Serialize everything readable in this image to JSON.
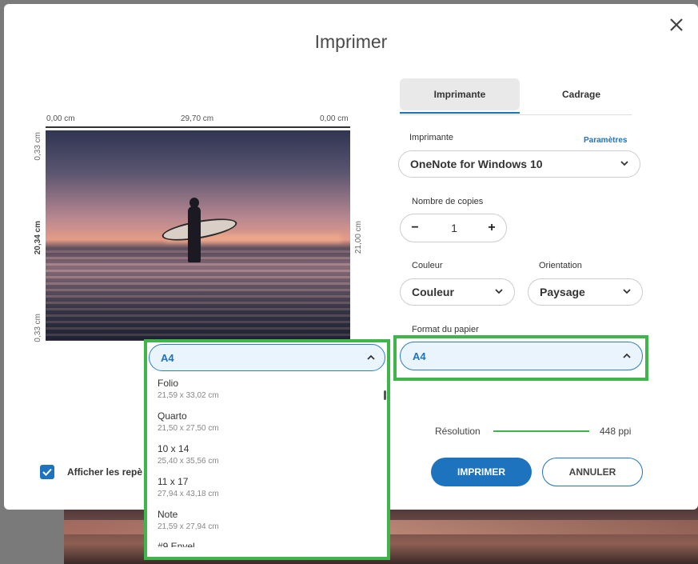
{
  "dialog": {
    "title": "Imprimer"
  },
  "preview": {
    "top_left": "0,00 cm",
    "top_center": "29,70 cm",
    "top_right": "0,00 cm",
    "left_top": "0,33 cm",
    "left_center": "20,34 cm",
    "left_bottom": "0,33 cm",
    "right_center": "21,00 cm"
  },
  "tabs": [
    {
      "label": "Imprimante"
    },
    {
      "label": "Cadrage"
    }
  ],
  "printer": {
    "label": "Imprimante",
    "settings_link": "Paramètres",
    "value": "OneNote for Windows 10"
  },
  "copies": {
    "label": "Nombre de copies",
    "value": "1",
    "minus": "−",
    "plus": "+"
  },
  "color": {
    "label": "Couleur",
    "value": "Couleur"
  },
  "orientation": {
    "label": "Orientation",
    "value": "Paysage"
  },
  "paper": {
    "label": "Format du papier",
    "value": "A4"
  },
  "resolution": {
    "label": "Résolution",
    "value": "448 ppi"
  },
  "buttons": {
    "print": "IMPRIMER",
    "cancel": "ANNULER"
  },
  "show_marks": {
    "label": "Afficher les repè",
    "checked": true
  },
  "dropdown": {
    "selected": "A4",
    "items": [
      {
        "name": "Folio",
        "dim": "21,59 x 33,02 cm"
      },
      {
        "name": "Quarto",
        "dim": "21,50 x 27,50 cm"
      },
      {
        "name": "10 x 14",
        "dim": "25,40 x 35,56 cm"
      },
      {
        "name": "11 x 17",
        "dim": "27,94 x 43,18 cm"
      },
      {
        "name": "Note",
        "dim": "21,59 x 27,94 cm"
      }
    ],
    "partial_item": "#9 Envel"
  },
  "colors": {
    "accent": "#1e73be",
    "highlight": "#3fb64a"
  },
  "icons": [
    "close-icon",
    "chevron-down-icon",
    "chevron-up-icon",
    "check-icon"
  ]
}
